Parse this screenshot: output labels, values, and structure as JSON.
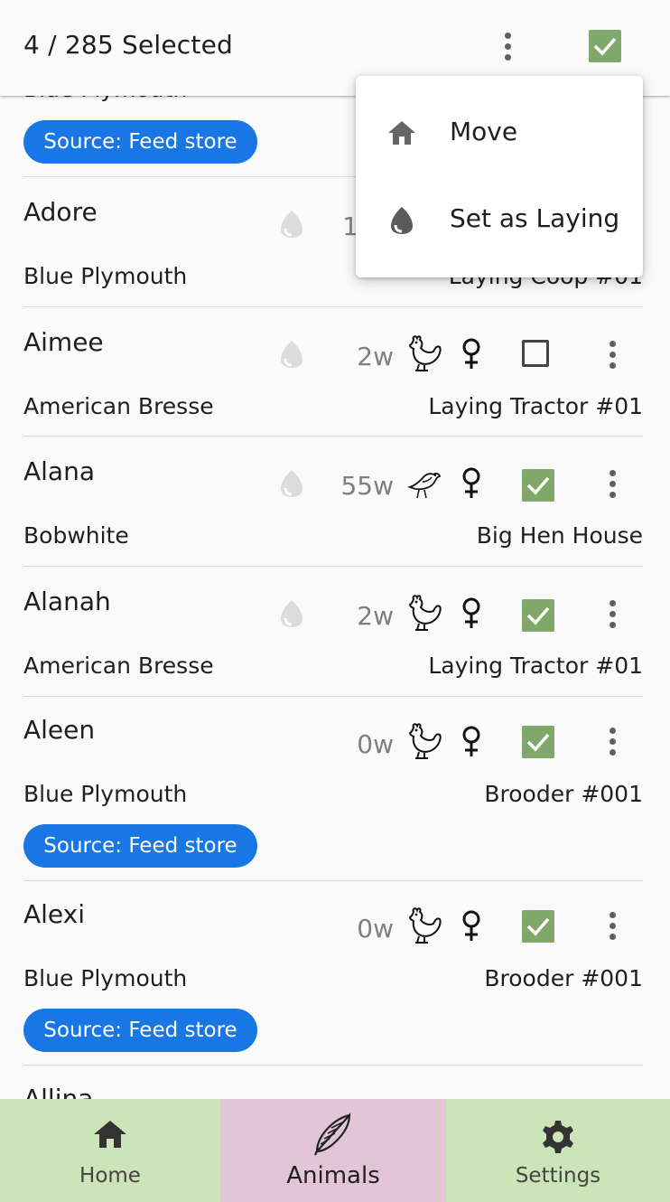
{
  "header": {
    "title": "4 / 285 Selected"
  },
  "menu": {
    "items": [
      {
        "label": "Move",
        "icon": "home-icon"
      },
      {
        "label": "Set as Laying",
        "icon": "egg-icon"
      }
    ]
  },
  "partial_row": {
    "breed": "Blue Plymouth",
    "chip": "Source: Feed store"
  },
  "rows": [
    {
      "name": "Adore",
      "age": "1",
      "breed": "Blue Plymouth",
      "location": "Laying Coop #01",
      "checked": false
    },
    {
      "name": "Aimee",
      "age": "2w",
      "breed": "American Bresse",
      "location": "Laying Tractor #01",
      "checked": false
    },
    {
      "name": "Alana",
      "age": "55w",
      "breed": "Bobwhite",
      "location": "Big Hen House",
      "checked": true
    },
    {
      "name": "Alanah",
      "age": "2w",
      "breed": "American Bresse",
      "location": "Laying Tractor #01",
      "checked": true
    },
    {
      "name": "Aleen",
      "age": "0w",
      "breed": "Blue Plymouth",
      "location": "Brooder #001",
      "checked": true,
      "chip": "Source: Feed store"
    },
    {
      "name": "Alexi",
      "age": "0w",
      "breed": "Blue Plymouth",
      "location": "Brooder #001",
      "checked": true,
      "chip": "Source: Feed store"
    },
    {
      "name": "Allina"
    }
  ],
  "nav": {
    "home": "Home",
    "animals": "Animals",
    "settings": "Settings"
  },
  "colors": {
    "accent_green": "#7fa86a",
    "chip_blue": "#1877e4",
    "nav_green": "#cce5b8",
    "nav_pink": "#e3c6d5"
  }
}
